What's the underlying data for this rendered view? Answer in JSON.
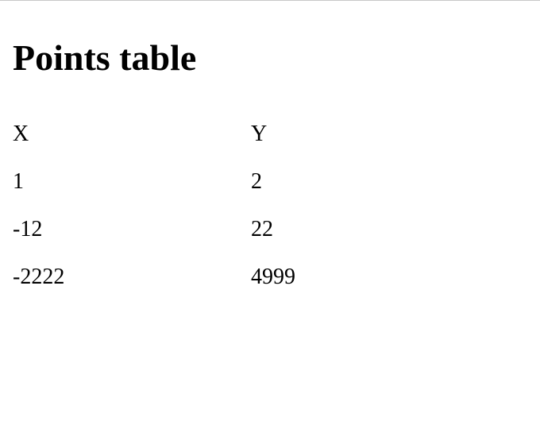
{
  "page": {
    "title": "Points table"
  },
  "table": {
    "headers": [
      "X",
      "Y"
    ],
    "rows": [
      [
        "1",
        "2"
      ],
      [
        "-12",
        "22"
      ],
      [
        "-2222",
        "4999"
      ]
    ]
  }
}
